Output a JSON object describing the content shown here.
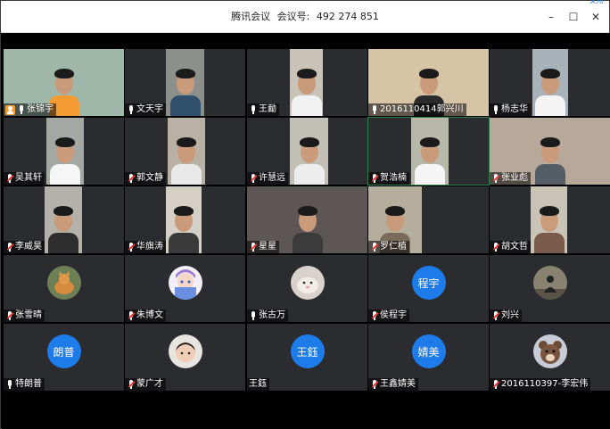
{
  "window": {
    "app_name": "腾讯会议",
    "meeting_label": "会议号:",
    "meeting_id": "492 274 851",
    "corner_tag": "文用",
    "controls": {
      "minimize": "–",
      "maximize": "☐",
      "close": "✕"
    }
  },
  "participants": [
    {
      "name": "张锦宇",
      "mic": "on",
      "host": true,
      "video": true
    },
    {
      "name": "文天宇",
      "mic": "on",
      "video": true
    },
    {
      "name": "王勔",
      "mic": "on",
      "video": true
    },
    {
      "name": "2016110414郭兴川",
      "mic": "on",
      "video": true
    },
    {
      "name": "杨志华",
      "mic": "on",
      "video": true
    },
    {
      "name": "吴其轩",
      "mic": "muted",
      "video": true
    },
    {
      "name": "郭文静",
      "mic": "muted",
      "video": true
    },
    {
      "name": "许慧远",
      "mic": "muted",
      "video": true
    },
    {
      "name": "贺浩楠",
      "mic": "muted",
      "video": true,
      "active": true
    },
    {
      "name": "张业彪",
      "mic": "muted",
      "video": true
    },
    {
      "name": "李威昊",
      "mic": "muted",
      "video": true
    },
    {
      "name": "华旗涛",
      "mic": "muted",
      "video": true
    },
    {
      "name": "星星",
      "mic": "muted",
      "video": true
    },
    {
      "name": "罗仁植",
      "mic": "muted",
      "video": true
    },
    {
      "name": "胡文哲",
      "mic": "muted",
      "video": true
    },
    {
      "name": "张雪晴",
      "mic": "muted",
      "avatar": "cat-photo-avatar"
    },
    {
      "name": "朱博文",
      "mic": "muted",
      "avatar": "anime-character-avatar"
    },
    {
      "name": "张古万",
      "mic": "on",
      "avatar": "pet-photo-avatar"
    },
    {
      "name": "侯程宇",
      "mic": "muted",
      "avatar_text": "程宇"
    },
    {
      "name": "刘兴",
      "mic": "muted",
      "avatar": "silhouette-photo-avatar"
    },
    {
      "name": "特朗普",
      "mic": "on",
      "avatar_text": "朗普"
    },
    {
      "name": "蒙广才",
      "mic": "muted",
      "avatar": "child-photo-avatar"
    },
    {
      "name": "王鈺",
      "mic": "none",
      "avatar_text": "王鈺"
    },
    {
      "name": "王鑫婧美",
      "mic": "muted",
      "avatar_text": "婧美"
    },
    {
      "name": "2016110397-李宏伟",
      "mic": "muted",
      "avatar": "bear-cartoon-avatar"
    }
  ],
  "colors": {
    "avatar_blue": "#1e7bea",
    "host_orange": "#f39c34",
    "muted_red": "#e53935",
    "active_border": "#2f7d4b"
  }
}
